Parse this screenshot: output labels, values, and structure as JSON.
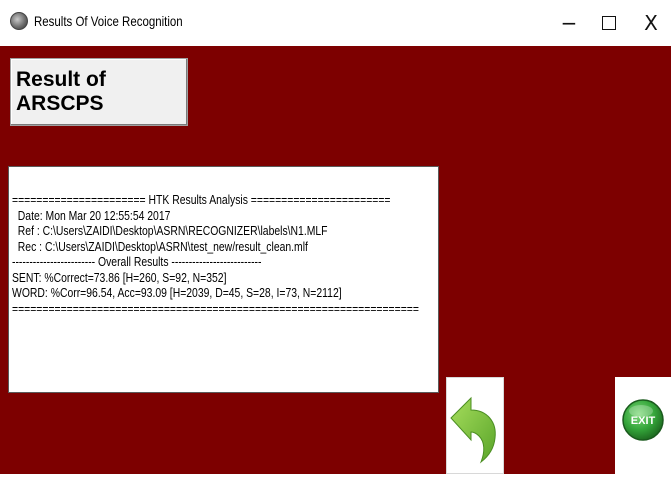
{
  "window": {
    "title": "Results Of Voice Recognition",
    "minimize_glyph": "−",
    "close_glyph": "X"
  },
  "colors": {
    "client_background": "#7d0000",
    "button_face": "#f0f0f0",
    "back_arrow": "#7fc240",
    "exit_circle": "#34a53a"
  },
  "result_button": {
    "label": "Result of ARSCPS"
  },
  "results": {
    "lines": [
      "====================== HTK Results Analysis =======================",
      "  Date: Mon Mar 20 12:55:54 2017",
      "  Ref : C:\\Users\\ZAIDI\\Desktop\\ASRN\\RECOGNIZER\\labels\\N1.MLF",
      "  Rec : C:\\Users\\ZAIDI\\Desktop\\ASRN\\test_new/result_clean.mlf",
      "------------------------ Overall Results --------------------------",
      "SENT: %Correct=73.86 [H=260, S=92, N=352]",
      "WORD: %Corr=96.54, Acc=93.09 [H=2039, D=45, S=28, I=73, N=2112]",
      "==================================================================="
    ]
  },
  "icons": {
    "app": "speaker-icon",
    "back": "back-arrow-icon",
    "exit": "exit-icon"
  },
  "exit_button": {
    "label": "EXIT"
  }
}
